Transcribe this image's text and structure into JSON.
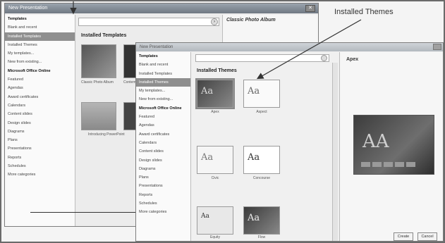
{
  "annotation": {
    "label": "Installed Themes"
  },
  "back_window": {
    "title": "New Presentation",
    "preview_title": "Classic Photo Album",
    "main_title": "Installed Templates",
    "sidebar": [
      "Templates",
      "Blank and recent",
      "Installed Templates",
      "Installed Themes",
      "My templates...",
      "New from existing...",
      "Microsoft Office Online",
      "Featured",
      "Agendas",
      "Award certificates",
      "Calendars",
      "Content slides",
      "Design slides",
      "Diagrams",
      "Plans",
      "Presentations",
      "Reports",
      "Schedules",
      "More categories"
    ],
    "thumbnail_captions": [
      "Classic Photo Album",
      "Contemporary Photo Album",
      "Introducing PowerPoint"
    ]
  },
  "front_window": {
    "title": "New Presentation",
    "main_title": "Installed Themes",
    "preview_title": "Apex",
    "sidebar": [
      "Templates",
      "Blank and recent",
      "Installed Templates",
      "Installed Themes",
      "My templates...",
      "New from existing...",
      "Microsoft Office Online",
      "Featured",
      "Agendas",
      "Award certificates",
      "Calendars",
      "Content slides",
      "Design slides",
      "Diagrams",
      "Plans",
      "Presentations",
      "Reports",
      "Schedules",
      "More categories"
    ],
    "themes": [
      "Apex",
      "Aspect",
      "Civic",
      "Concourse",
      "Equity",
      "Flow"
    ],
    "buttons": {
      "create": "Create",
      "cancel": "Cancel"
    }
  }
}
